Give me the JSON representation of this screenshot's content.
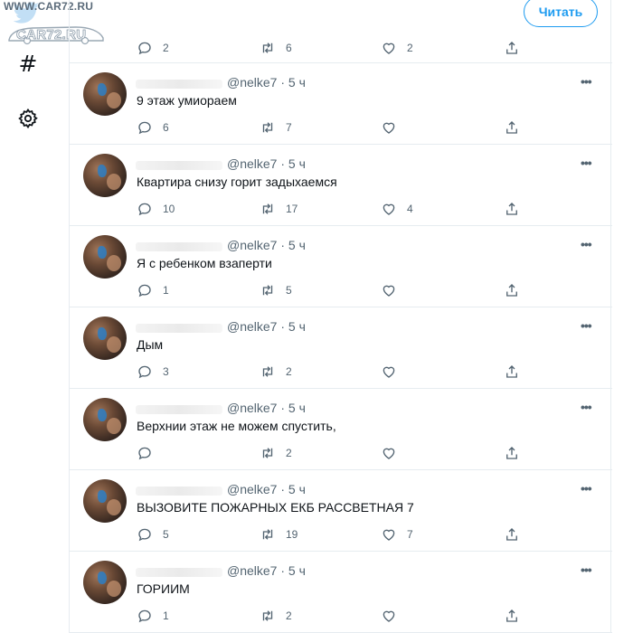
{
  "watermark": {
    "url": "WWW.CAR72.RU",
    "brand": "CAR72.RU"
  },
  "rail": {
    "icons": [
      "hashtag-icon",
      "settings-icon"
    ]
  },
  "follow_button": "Читать",
  "top_stats": {
    "replies": "2",
    "retweets": "6",
    "likes": "2"
  },
  "tweets": [
    {
      "handle": "@nelke7",
      "time": "5 ч",
      "text": "9 этаж умиораем",
      "replies": "6",
      "retweets": "7",
      "likes": ""
    },
    {
      "handle": "@nelke7",
      "time": "5 ч",
      "text": "Квартира снизу горит задыхаемся",
      "replies": "10",
      "retweets": "17",
      "likes": "4"
    },
    {
      "handle": "@nelke7",
      "time": "5 ч",
      "text": "Я с ребенком взаперти",
      "replies": "1",
      "retweets": "5",
      "likes": ""
    },
    {
      "handle": "@nelke7",
      "time": "5 ч",
      "text": "Дым",
      "replies": "3",
      "retweets": "2",
      "likes": ""
    },
    {
      "handle": "@nelke7",
      "time": "5 ч",
      "text": "Верхнии этаж не можем спустить,",
      "replies": "",
      "retweets": "2",
      "likes": ""
    },
    {
      "handle": "@nelke7",
      "time": "5 ч",
      "text": "ВЫЗОВИТЕ ПОЖАРНЫХ ЕКБ РАССВЕТНАЯ 7",
      "replies": "5",
      "retweets": "19",
      "likes": "7"
    },
    {
      "handle": "@nelke7",
      "time": "5 ч",
      "text": "ГОРИИМ",
      "replies": "1",
      "retweets": "2",
      "likes": ""
    }
  ],
  "colors": {
    "accent": "#1d9bf0",
    "muted": "#536471",
    "divider": "#e6ecf0"
  }
}
